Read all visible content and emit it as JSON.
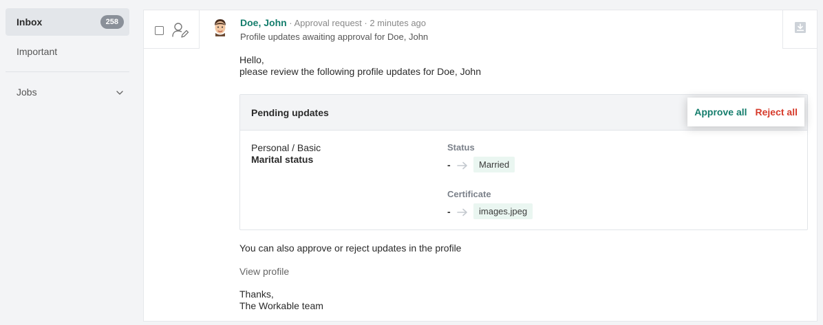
{
  "sidebar": {
    "inbox": {
      "label": "Inbox",
      "count": "258"
    },
    "important": {
      "label": "Important"
    },
    "jobs": {
      "label": "Jobs"
    }
  },
  "message": {
    "sender": "Doe, John",
    "meta": " · Approval request · 2 minutes ago",
    "subject": "Profile updates awaiting approval for Doe, John",
    "greeting": "Hello,",
    "intro": "please review the following profile updates for Doe, John",
    "pending": {
      "title": "Pending updates",
      "approve_label": "Approve all",
      "reject_label": "Reject all",
      "section": "Personal / Basic",
      "field_name": "Marital status",
      "fields": [
        {
          "label": "Status",
          "old": "-",
          "new": "Married"
        },
        {
          "label": "Certificate",
          "old": "-",
          "new": "images.jpeg"
        }
      ]
    },
    "outro": "You can also approve or reject updates in the profile",
    "view_profile_label": "View profile",
    "sign_thanks": "Thanks,",
    "sign_team": "The Workable team"
  },
  "colors": {
    "brand": "#147d6c",
    "reject": "#d63a2a",
    "badge": "#8a9099"
  },
  "icons": {
    "assign": "user-pencil-icon",
    "archive": "archive-download-icon",
    "jobs_toggle": "chevron-down-icon",
    "change": "arrow-right-icon"
  }
}
